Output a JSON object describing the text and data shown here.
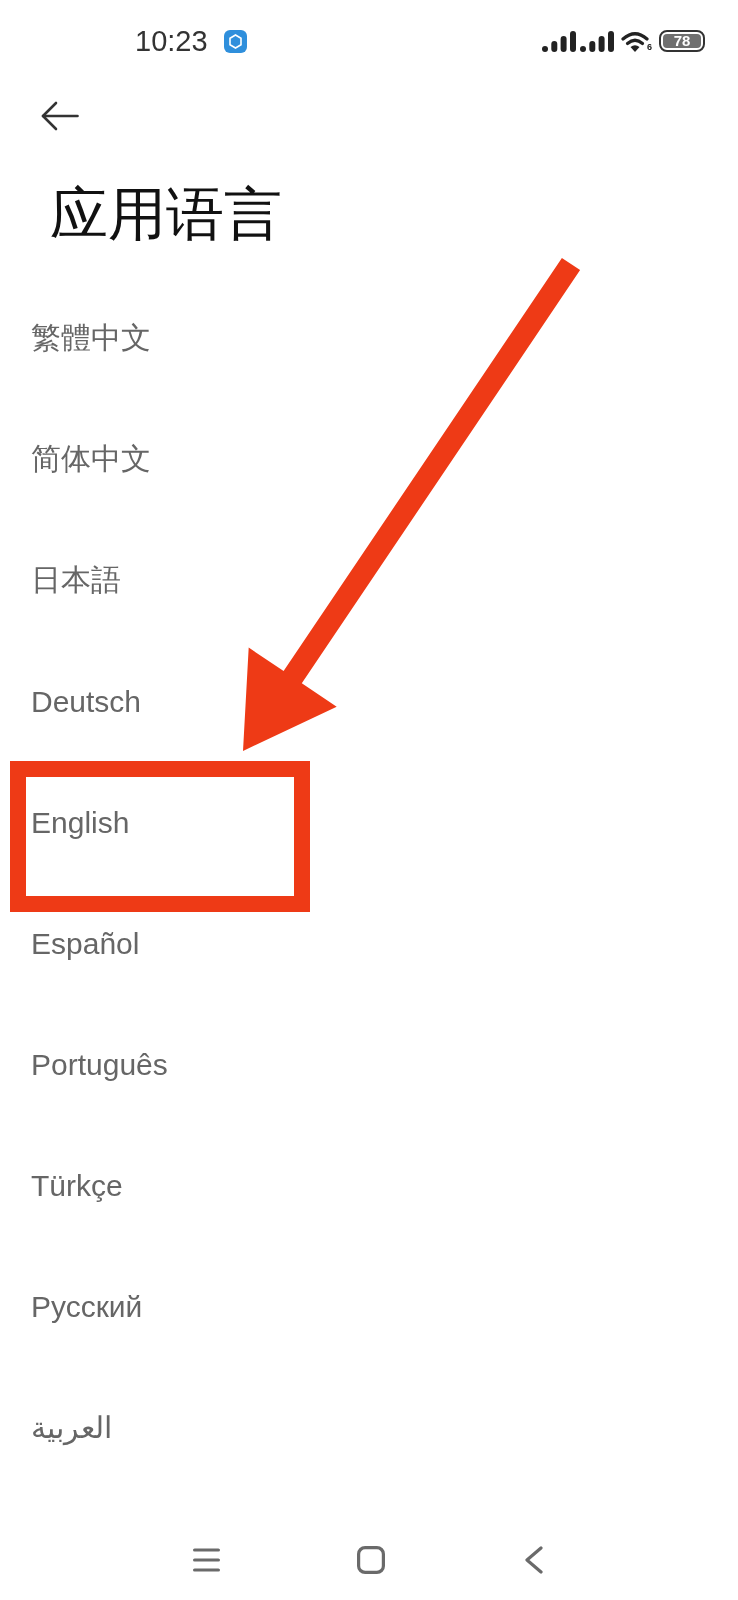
{
  "status_bar": {
    "time": "10:23",
    "wifi_label": "6",
    "battery": "78"
  },
  "header": {
    "title": "应用语言"
  },
  "languages": [
    {
      "label": "繁體中文",
      "highlighted": false
    },
    {
      "label": "简体中文",
      "highlighted": false
    },
    {
      "label": "日本語",
      "highlighted": false
    },
    {
      "label": "Deutsch",
      "highlighted": false
    },
    {
      "label": "English",
      "highlighted": true
    },
    {
      "label": "Español",
      "highlighted": false
    },
    {
      "label": "Português",
      "highlighted": false
    },
    {
      "label": "Türkçe",
      "highlighted": false
    },
    {
      "label": "Русский",
      "highlighted": false
    },
    {
      "label": "العربية",
      "highlighted": false
    }
  ]
}
